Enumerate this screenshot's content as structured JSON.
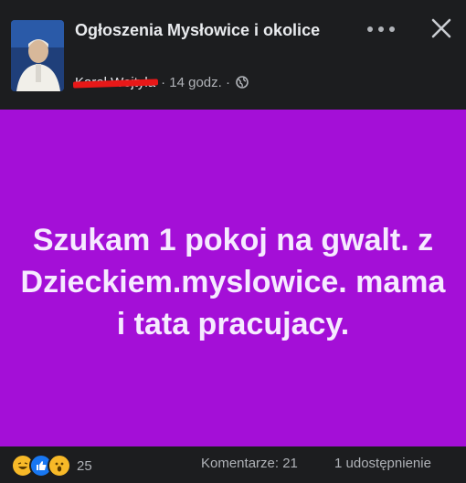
{
  "header": {
    "group_name": "Ogłoszenia Mysłowice i okolice",
    "author_name": "Karol Wojtyla",
    "time": "· 14 godz. ·",
    "globe_icon": "globe-icon",
    "more_icon": "more-horizontal-icon",
    "close_icon": "close-icon"
  },
  "post": {
    "text": "Szukam 1 pokoj na gwalt. z Dzieckiem.myslowice. mama i tata pracujacy.",
    "background_color": "#a40fd7"
  },
  "footer": {
    "reaction_icons": [
      "haha-icon",
      "like-icon",
      "wow-icon"
    ],
    "reaction_count": "25",
    "comments": "Komentarze: 21",
    "shares": "1 udostępnienie"
  }
}
